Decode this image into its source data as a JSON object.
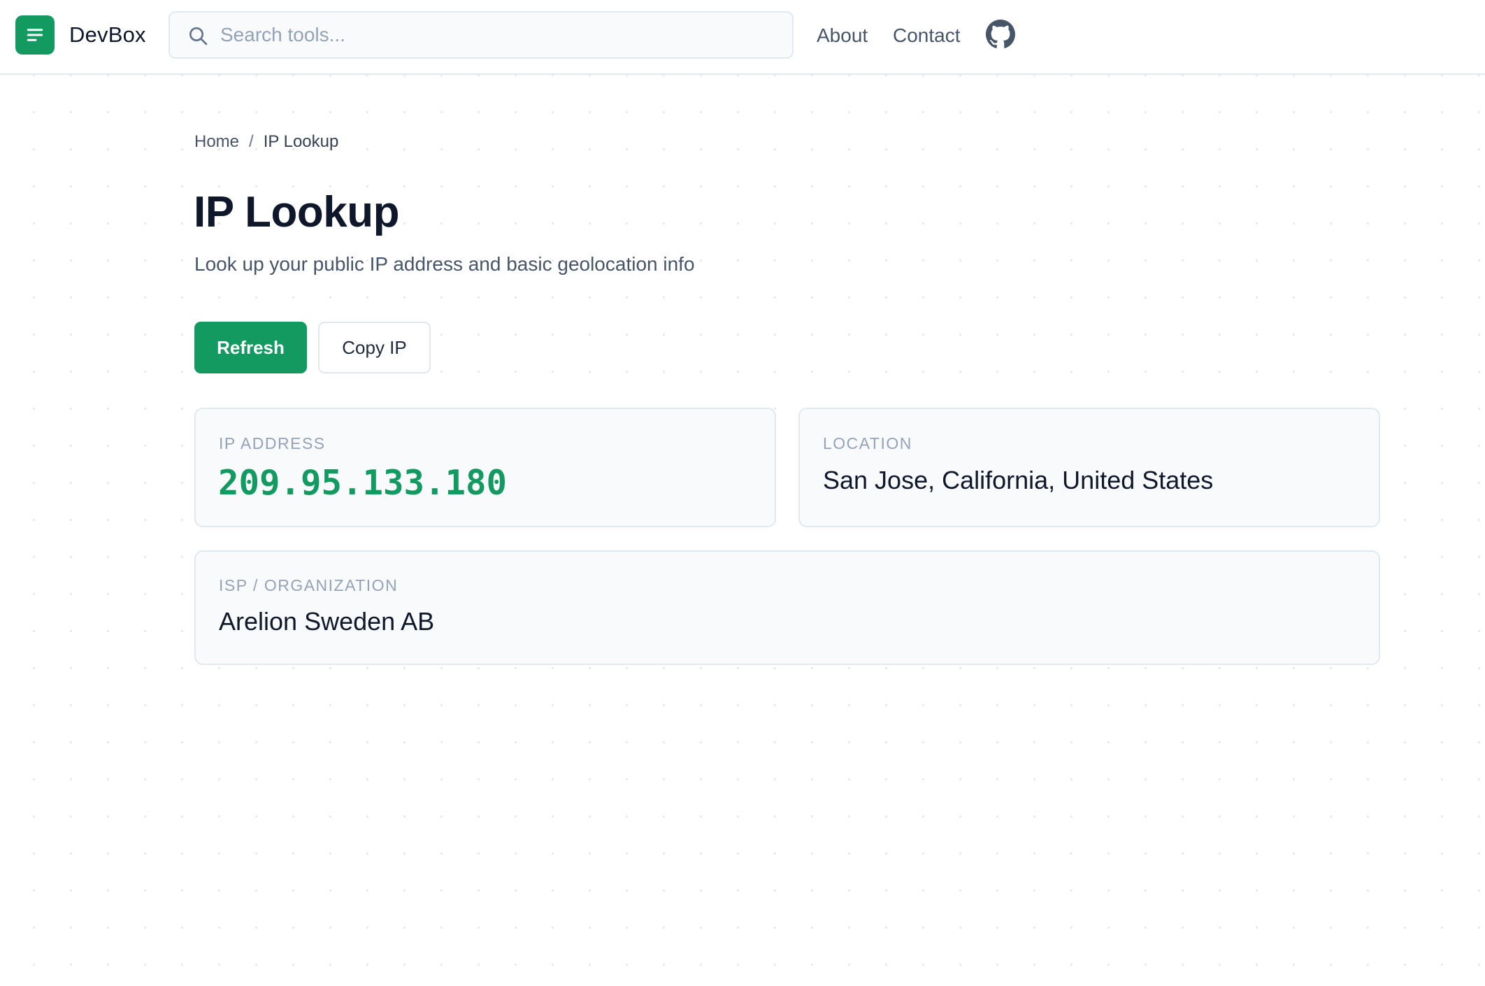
{
  "header": {
    "brand": "DevBox",
    "search_placeholder": "Search tools...",
    "nav": {
      "about": "About",
      "contact": "Contact"
    }
  },
  "breadcrumb": {
    "home": "Home",
    "separator": "/",
    "current": "IP Lookup"
  },
  "page": {
    "title": "IP Lookup",
    "subtitle": "Look up your public IP address and basic geolocation info"
  },
  "actions": {
    "refresh_label": "Refresh",
    "copy_label": "Copy IP"
  },
  "results": {
    "ip": {
      "label": "IP ADDRESS",
      "value": "209.95.133.180"
    },
    "location": {
      "label": "LOCATION",
      "value": "San Jose, California, United States"
    },
    "isp": {
      "label": "ISP / ORGANIZATION",
      "value": "Arelion Sweden AB"
    }
  },
  "colors": {
    "accent": "#139a61",
    "text": "#0f172a",
    "muted": "#94a3b8",
    "card_bg": "#f8fafc",
    "border": "#e2e8f0"
  },
  "icons": {
    "logo": "menu-lines-icon",
    "search": "search-icon",
    "github": "github-icon"
  }
}
